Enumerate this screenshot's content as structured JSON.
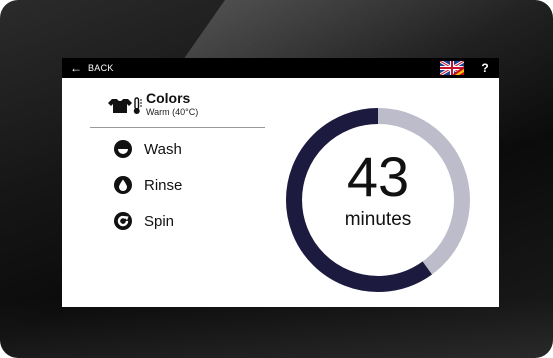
{
  "topbar": {
    "back_label": "BACK",
    "help_label": "?",
    "language_icon": "uk-spain-flag-icon"
  },
  "program": {
    "icons": [
      "tshirt-icon",
      "thermometer-icon"
    ],
    "name": "Colors",
    "temperature": "Warm (40°C)"
  },
  "steps": [
    {
      "label": "Wash",
      "icon": "wash-icon"
    },
    {
      "label": "Rinse",
      "icon": "drop-icon"
    },
    {
      "label": "Spin",
      "icon": "spin-icon"
    }
  ],
  "timer": {
    "value": "43",
    "unit": "minutes",
    "progress_fraction": 0.6
  },
  "colors": {
    "ring_filled": "#1c1a3e",
    "ring_remaining": "#bdbccb",
    "topbar_bg": "#000000"
  }
}
